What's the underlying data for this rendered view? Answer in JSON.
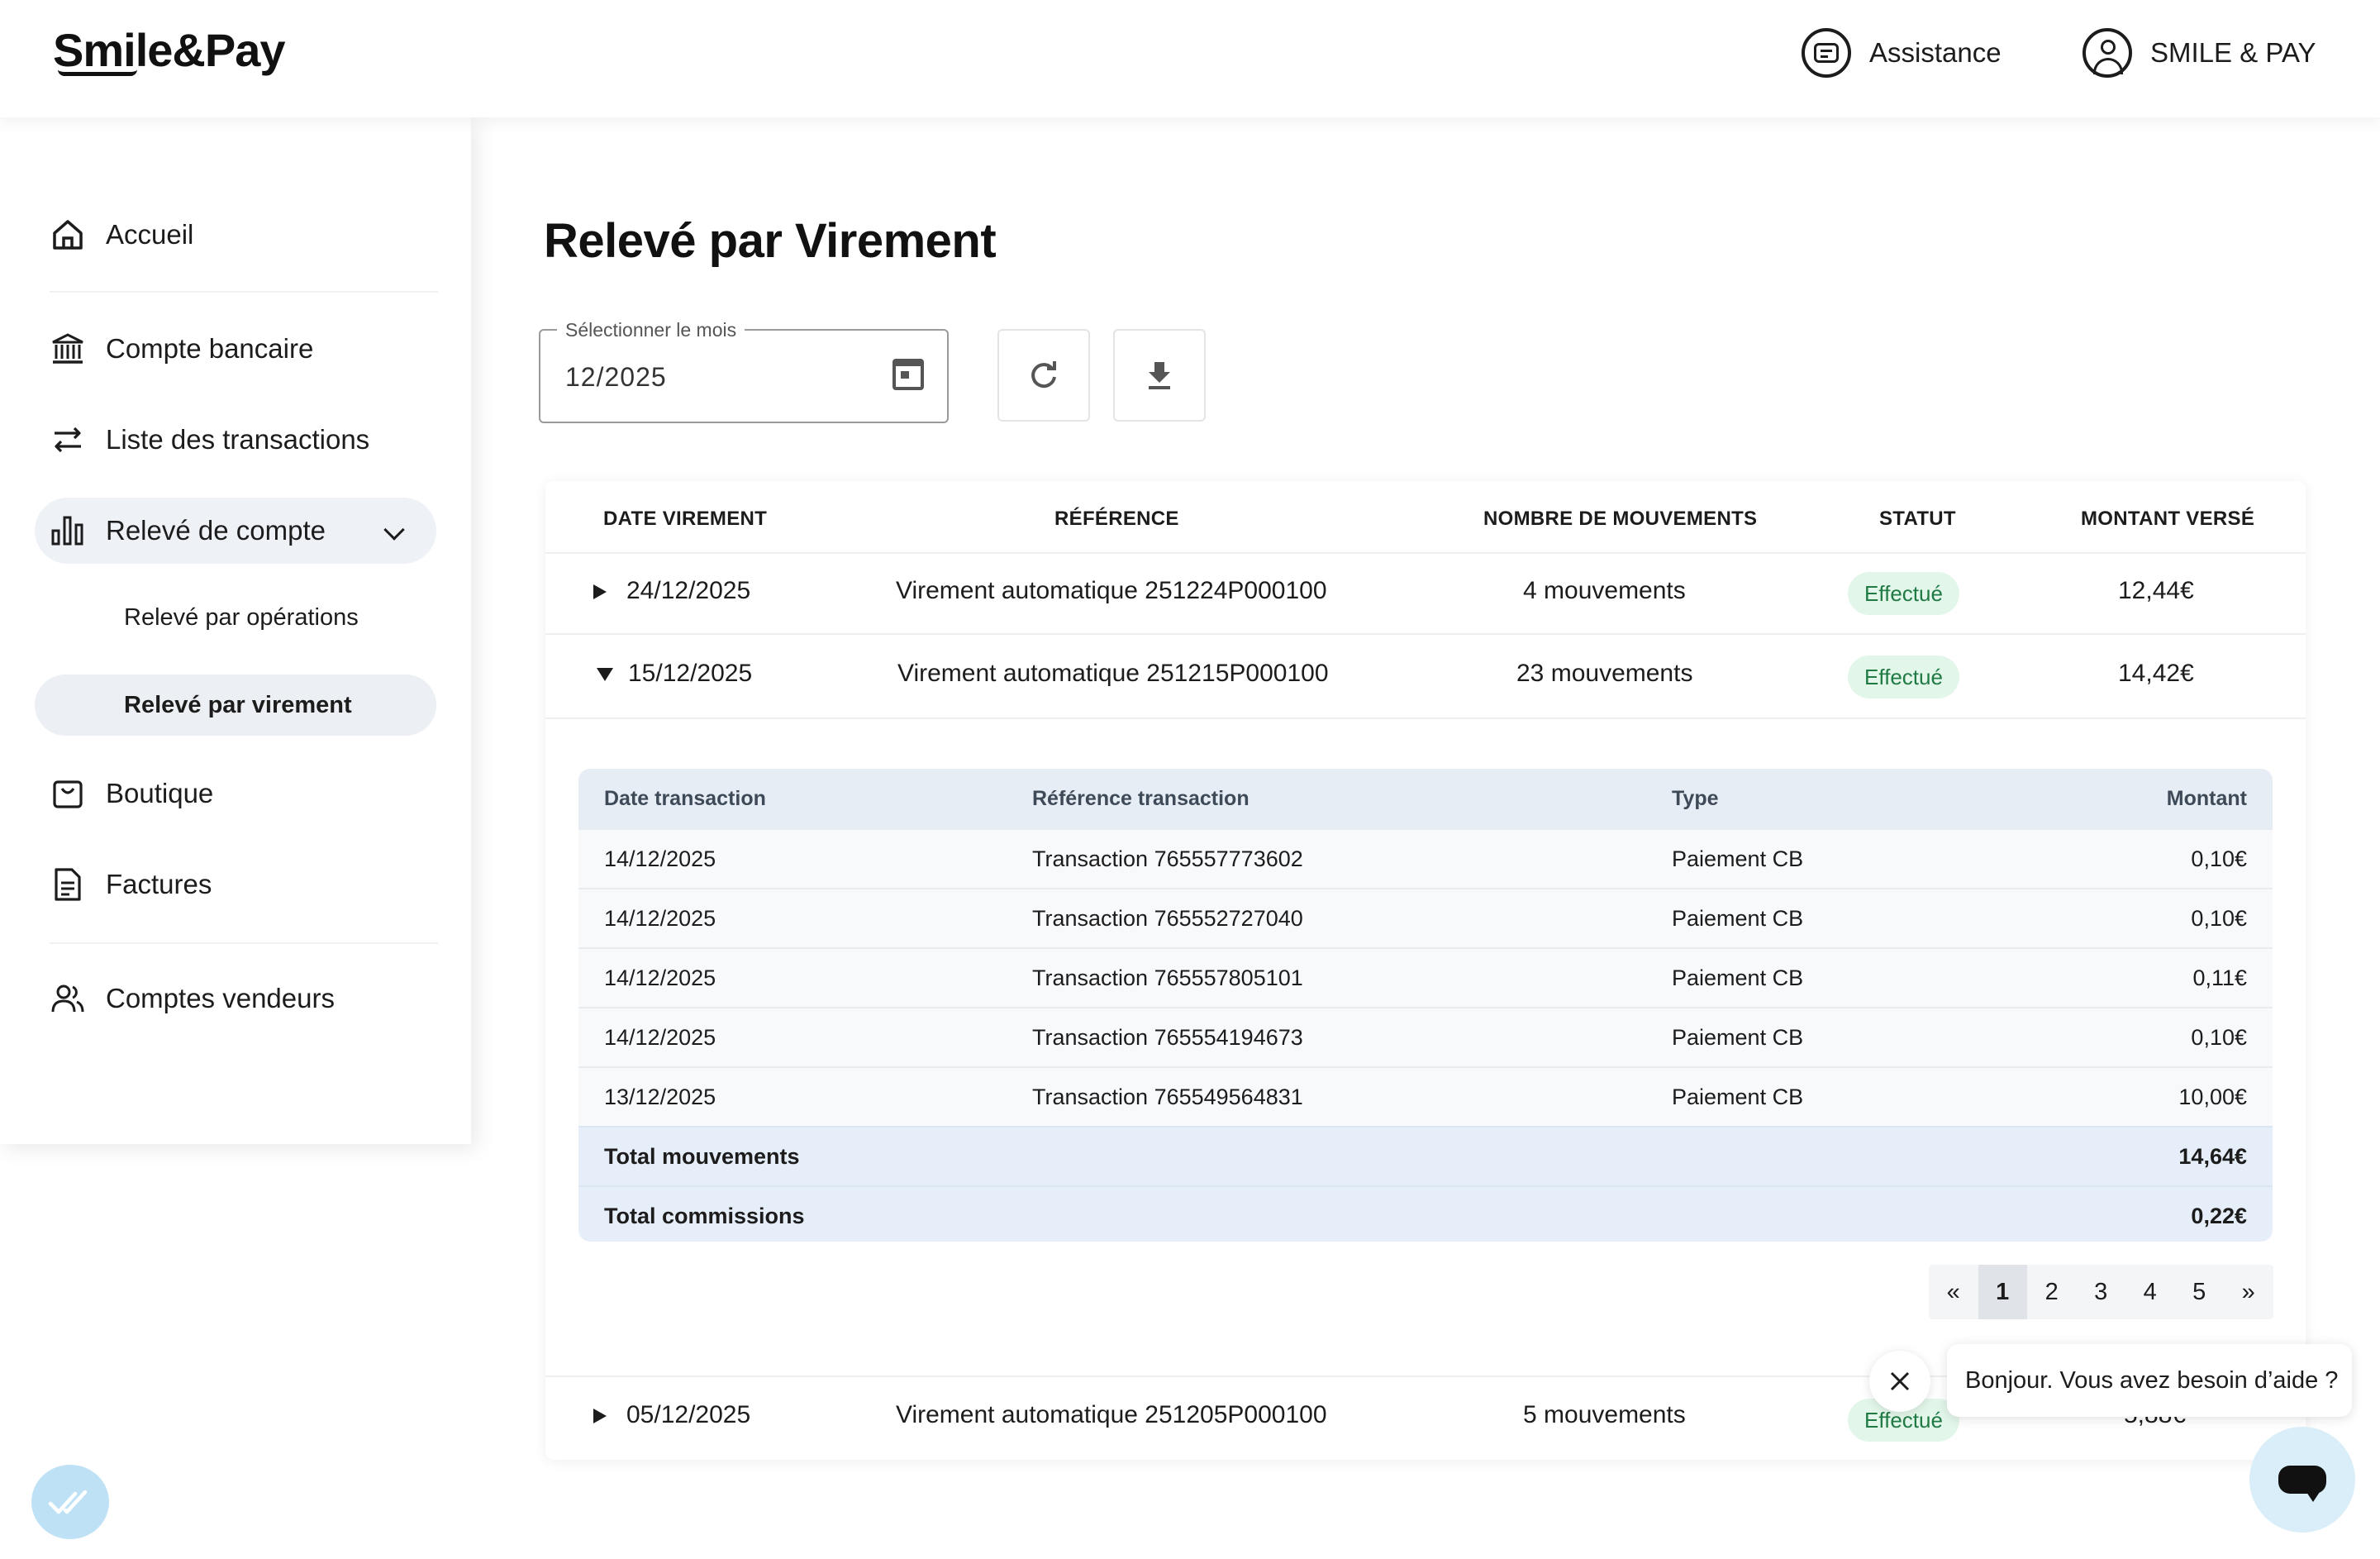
{
  "header": {
    "logo": "Smile&Pay",
    "assistance_label": "Assistance",
    "account_label": "SMILE & PAY"
  },
  "sidebar": {
    "items": [
      {
        "label": "Accueil",
        "icon": "home-icon"
      },
      {
        "label": "Compte bancaire",
        "icon": "bank-icon"
      },
      {
        "label": "Liste des transactions",
        "icon": "transfer-arrows-icon"
      },
      {
        "label": "Relevé de compte",
        "icon": "bar-chart-icon"
      },
      {
        "label": "Boutique",
        "icon": "shopping-bag-icon"
      },
      {
        "label": "Factures",
        "icon": "document-icon"
      },
      {
        "label": "Comptes vendeurs",
        "icon": "users-icon"
      }
    ],
    "subitems": [
      {
        "label": "Relevé par opérations"
      },
      {
        "label": "Relevé par virement"
      }
    ]
  },
  "main": {
    "title": "Relevé par Virement",
    "month_picker": {
      "label": "Sélectionner le mois",
      "value": "12/2025"
    },
    "table": {
      "headers": [
        "DATE VIREMENT",
        "RÉFÉRENCE",
        "NOMBRE DE MOUVEMENTS",
        "STATUT",
        "MONTANT VERSÉ"
      ],
      "rows": [
        {
          "date": "24/12/2025",
          "reference": "Virement automatique 251224P000100",
          "movements": "4 mouvements",
          "status": "Effectué",
          "amount": "12,44€"
        },
        {
          "date": "15/12/2025",
          "reference": "Virement automatique 251215P000100",
          "movements": "23 mouvements",
          "status": "Effectué",
          "amount": "14,42€"
        },
        {
          "date": "05/12/2025",
          "reference": "Virement automatique 251205P000100",
          "movements": "5 mouvements",
          "status": "Effectué",
          "amount": "5,88€"
        }
      ]
    },
    "detail": {
      "headers": [
        "Date transaction",
        "Référence transaction",
        "Type",
        "Montant"
      ],
      "rows": [
        {
          "date": "14/12/2025",
          "reference": "Transaction 765557773602",
          "type": "Paiement CB",
          "amount": "0,10€"
        },
        {
          "date": "14/12/2025",
          "reference": "Transaction 765552727040",
          "type": "Paiement CB",
          "amount": "0,10€"
        },
        {
          "date": "14/12/2025",
          "reference": "Transaction 765557805101",
          "type": "Paiement CB",
          "amount": "0,11€"
        },
        {
          "date": "14/12/2025",
          "reference": "Transaction 765554194673",
          "type": "Paiement CB",
          "amount": "0,10€"
        },
        {
          "date": "13/12/2025",
          "reference": "Transaction 765549564831",
          "type": "Paiement CB",
          "amount": "10,00€"
        }
      ],
      "totals": [
        {
          "label": "Total mouvements",
          "value": "14,64€"
        },
        {
          "label": "Total commissions",
          "value": "0,22€"
        }
      ]
    },
    "pagination": {
      "prev": "«",
      "pages": [
        "1",
        "2",
        "3",
        "4",
        "5"
      ],
      "next": "»",
      "current": "1"
    }
  },
  "chat": {
    "greeting": "Bonjour. Vous avez besoin d’aide ?"
  },
  "colors": {
    "status_badge_bg": "#e3f6ea",
    "status_badge_text": "#1f7a44",
    "inner_header_bg": "#e6edf5",
    "chat_launcher_bg": "#d9eef9"
  }
}
